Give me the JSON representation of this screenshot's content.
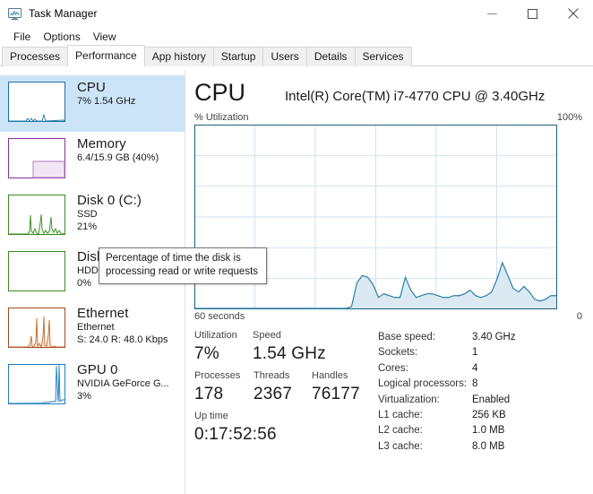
{
  "window": {
    "title": "Task Manager",
    "icon": "task-manager-icon",
    "buttons": {
      "minimize": "minimize-icon",
      "maximize": "maximize-icon",
      "close": "close-icon"
    }
  },
  "menu": {
    "items": [
      "File",
      "Options",
      "View"
    ]
  },
  "tabs": [
    {
      "label": "Processes",
      "active": false
    },
    {
      "label": "Performance",
      "active": true
    },
    {
      "label": "App history",
      "active": false
    },
    {
      "label": "Startup",
      "active": false
    },
    {
      "label": "Users",
      "active": false
    },
    {
      "label": "Details",
      "active": false
    },
    {
      "label": "Services",
      "active": false
    }
  ],
  "sidebar": {
    "items": [
      {
        "name": "CPU",
        "line2": "7%  1.54 GHz",
        "line3": "",
        "selected": true,
        "color": "#1f6fa8"
      },
      {
        "name": "Memory",
        "line2": "6.4/15.9 GB (40%)",
        "line3": "",
        "selected": false,
        "color": "#8b2fa0"
      },
      {
        "name": "Disk 0 (C:)",
        "line2": "SSD",
        "line3": "21%",
        "selected": false,
        "color": "#3a8a21"
      },
      {
        "name": "Disk 1 (D:)",
        "line2": "HDD",
        "line3": "0%",
        "selected": false,
        "color": "#3a8a21"
      },
      {
        "name": "Ethernet",
        "line2": "Ethernet",
        "line3": "S: 24.0 R: 48.0 Kbps",
        "selected": false,
        "color": "#a64b1e"
      },
      {
        "name": "GPU 0",
        "line2": "NVIDIA GeForce G...",
        "line3": "3%",
        "selected": false,
        "color": "#1f7fc0"
      }
    ]
  },
  "main": {
    "title": "CPU",
    "subtitle": "Intel(R) Core(TM) i7-4770 CPU @ 3.40GHz",
    "graph_top_left_label": "% Utilization",
    "graph_top_right_label": "100%",
    "graph_bottom_left_label": "60 seconds",
    "graph_bottom_right_label": "0",
    "stats_left": {
      "utilization_label": "Utilization",
      "utilization_value": "7%",
      "speed_label": "Speed",
      "speed_value": "1.54 GHz",
      "processes_label": "Processes",
      "processes_value": "178",
      "threads_label": "Threads",
      "threads_value": "2367",
      "handles_label": "Handles",
      "handles_value": "76177",
      "uptime_label": "Up time",
      "uptime_value": "0:17:52:56"
    },
    "stats_right": [
      {
        "key": "Base speed:",
        "value": "3.40 GHz"
      },
      {
        "key": "Sockets:",
        "value": "1"
      },
      {
        "key": "Cores:",
        "value": "4"
      },
      {
        "key": "Logical processors:",
        "value": "8"
      },
      {
        "key": "Virtualization:",
        "value": "Enabled"
      },
      {
        "key": "L1 cache:",
        "value": "256 KB"
      },
      {
        "key": "L2 cache:",
        "value": "1.0 MB"
      },
      {
        "key": "L3 cache:",
        "value": "8.0 MB"
      }
    ]
  },
  "tooltip": {
    "text": "Percentage of time the disk is processing read or write requests"
  },
  "colors": {
    "accent_blue": "#1f6fa8",
    "selection_blue": "#cce4f7",
    "graph_line": "#2a7fa8",
    "graph_fill": "#dbe9f2",
    "grid": "#cfe2ee"
  },
  "chart_data": {
    "type": "area",
    "title": "% Utilization",
    "xlabel": "60 seconds",
    "ylabel": "% Utilization",
    "ylim": [
      0,
      100
    ],
    "xlim": [
      60,
      0
    ],
    "grid": true,
    "y_axis_max_label": "100%",
    "x_axis_left_label": "60 seconds",
    "x_axis_right_label": "0",
    "grid_rows": 6,
    "grid_cols": 6,
    "series": [
      {
        "name": "CPU Utilization",
        "values": [
          0,
          0,
          0,
          0,
          0,
          0,
          0,
          0,
          0,
          0,
          0,
          0,
          0,
          0,
          0,
          0,
          0,
          0,
          0,
          0,
          0,
          0,
          0,
          0,
          0,
          0,
          0,
          0,
          0,
          1,
          14,
          18,
          17,
          13,
          6,
          8,
          7,
          6,
          6,
          17,
          10,
          6,
          7,
          8,
          8,
          7,
          6,
          6,
          7,
          7,
          8,
          10,
          7,
          6,
          7,
          9,
          16,
          25,
          18,
          11,
          9,
          12,
          9,
          5,
          4,
          5,
          7,
          7
        ]
      }
    ]
  }
}
